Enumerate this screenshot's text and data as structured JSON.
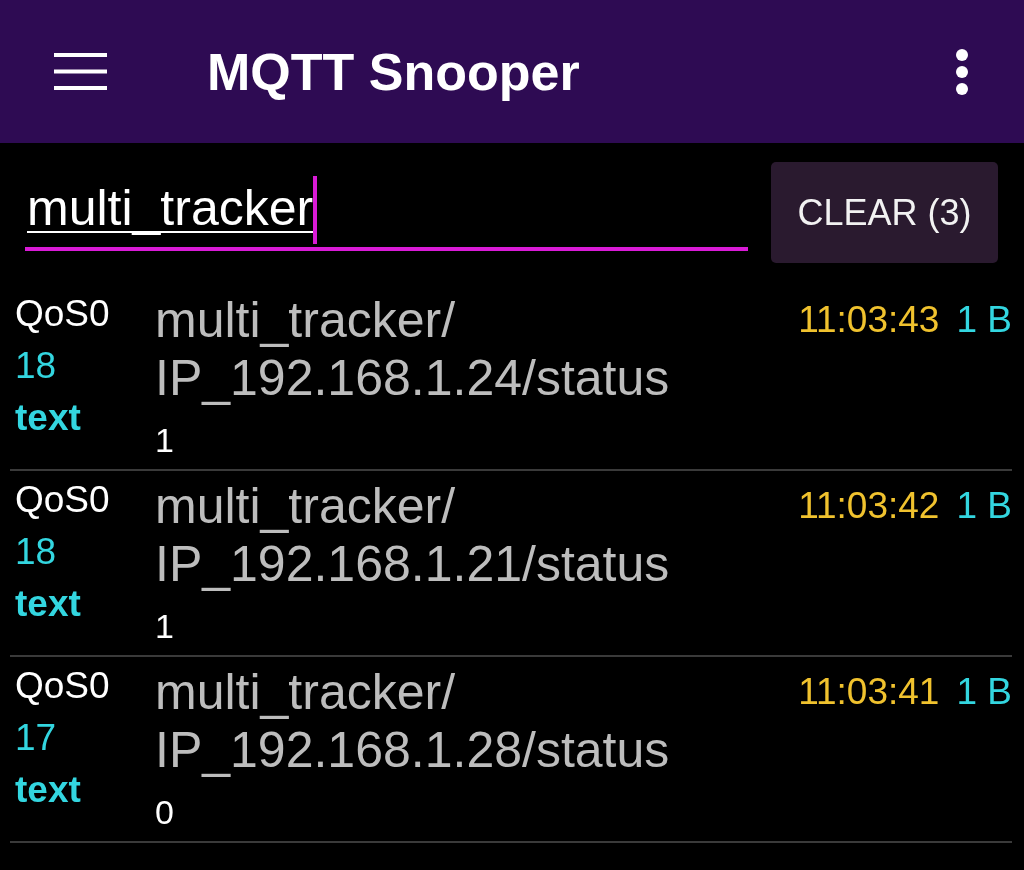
{
  "app_bar": {
    "title": "MQTT Snooper"
  },
  "filter": {
    "value": "multi_tracker",
    "focused": true
  },
  "clear_button": {
    "label": "CLEAR (3)"
  },
  "messages": [
    {
      "qos": "QoS0",
      "length": "18",
      "format": "text",
      "topic_lines": [
        "multi_tracker/",
        "IP_192.168.1.24/status"
      ],
      "payload": "1",
      "time": "11:03:43",
      "size": "1 B"
    },
    {
      "qos": "QoS0",
      "length": "18",
      "format": "text",
      "topic_lines": [
        "multi_tracker/",
        "IP_192.168.1.21/status"
      ],
      "payload": "1",
      "time": "11:03:42",
      "size": "1 B"
    },
    {
      "qos": "QoS0",
      "length": "17",
      "format": "text",
      "topic_lines": [
        "multi_tracker/",
        "IP_192.168.1.28/status"
      ],
      "payload": "0",
      "time": "11:03:41",
      "size": "1 B"
    }
  ]
}
